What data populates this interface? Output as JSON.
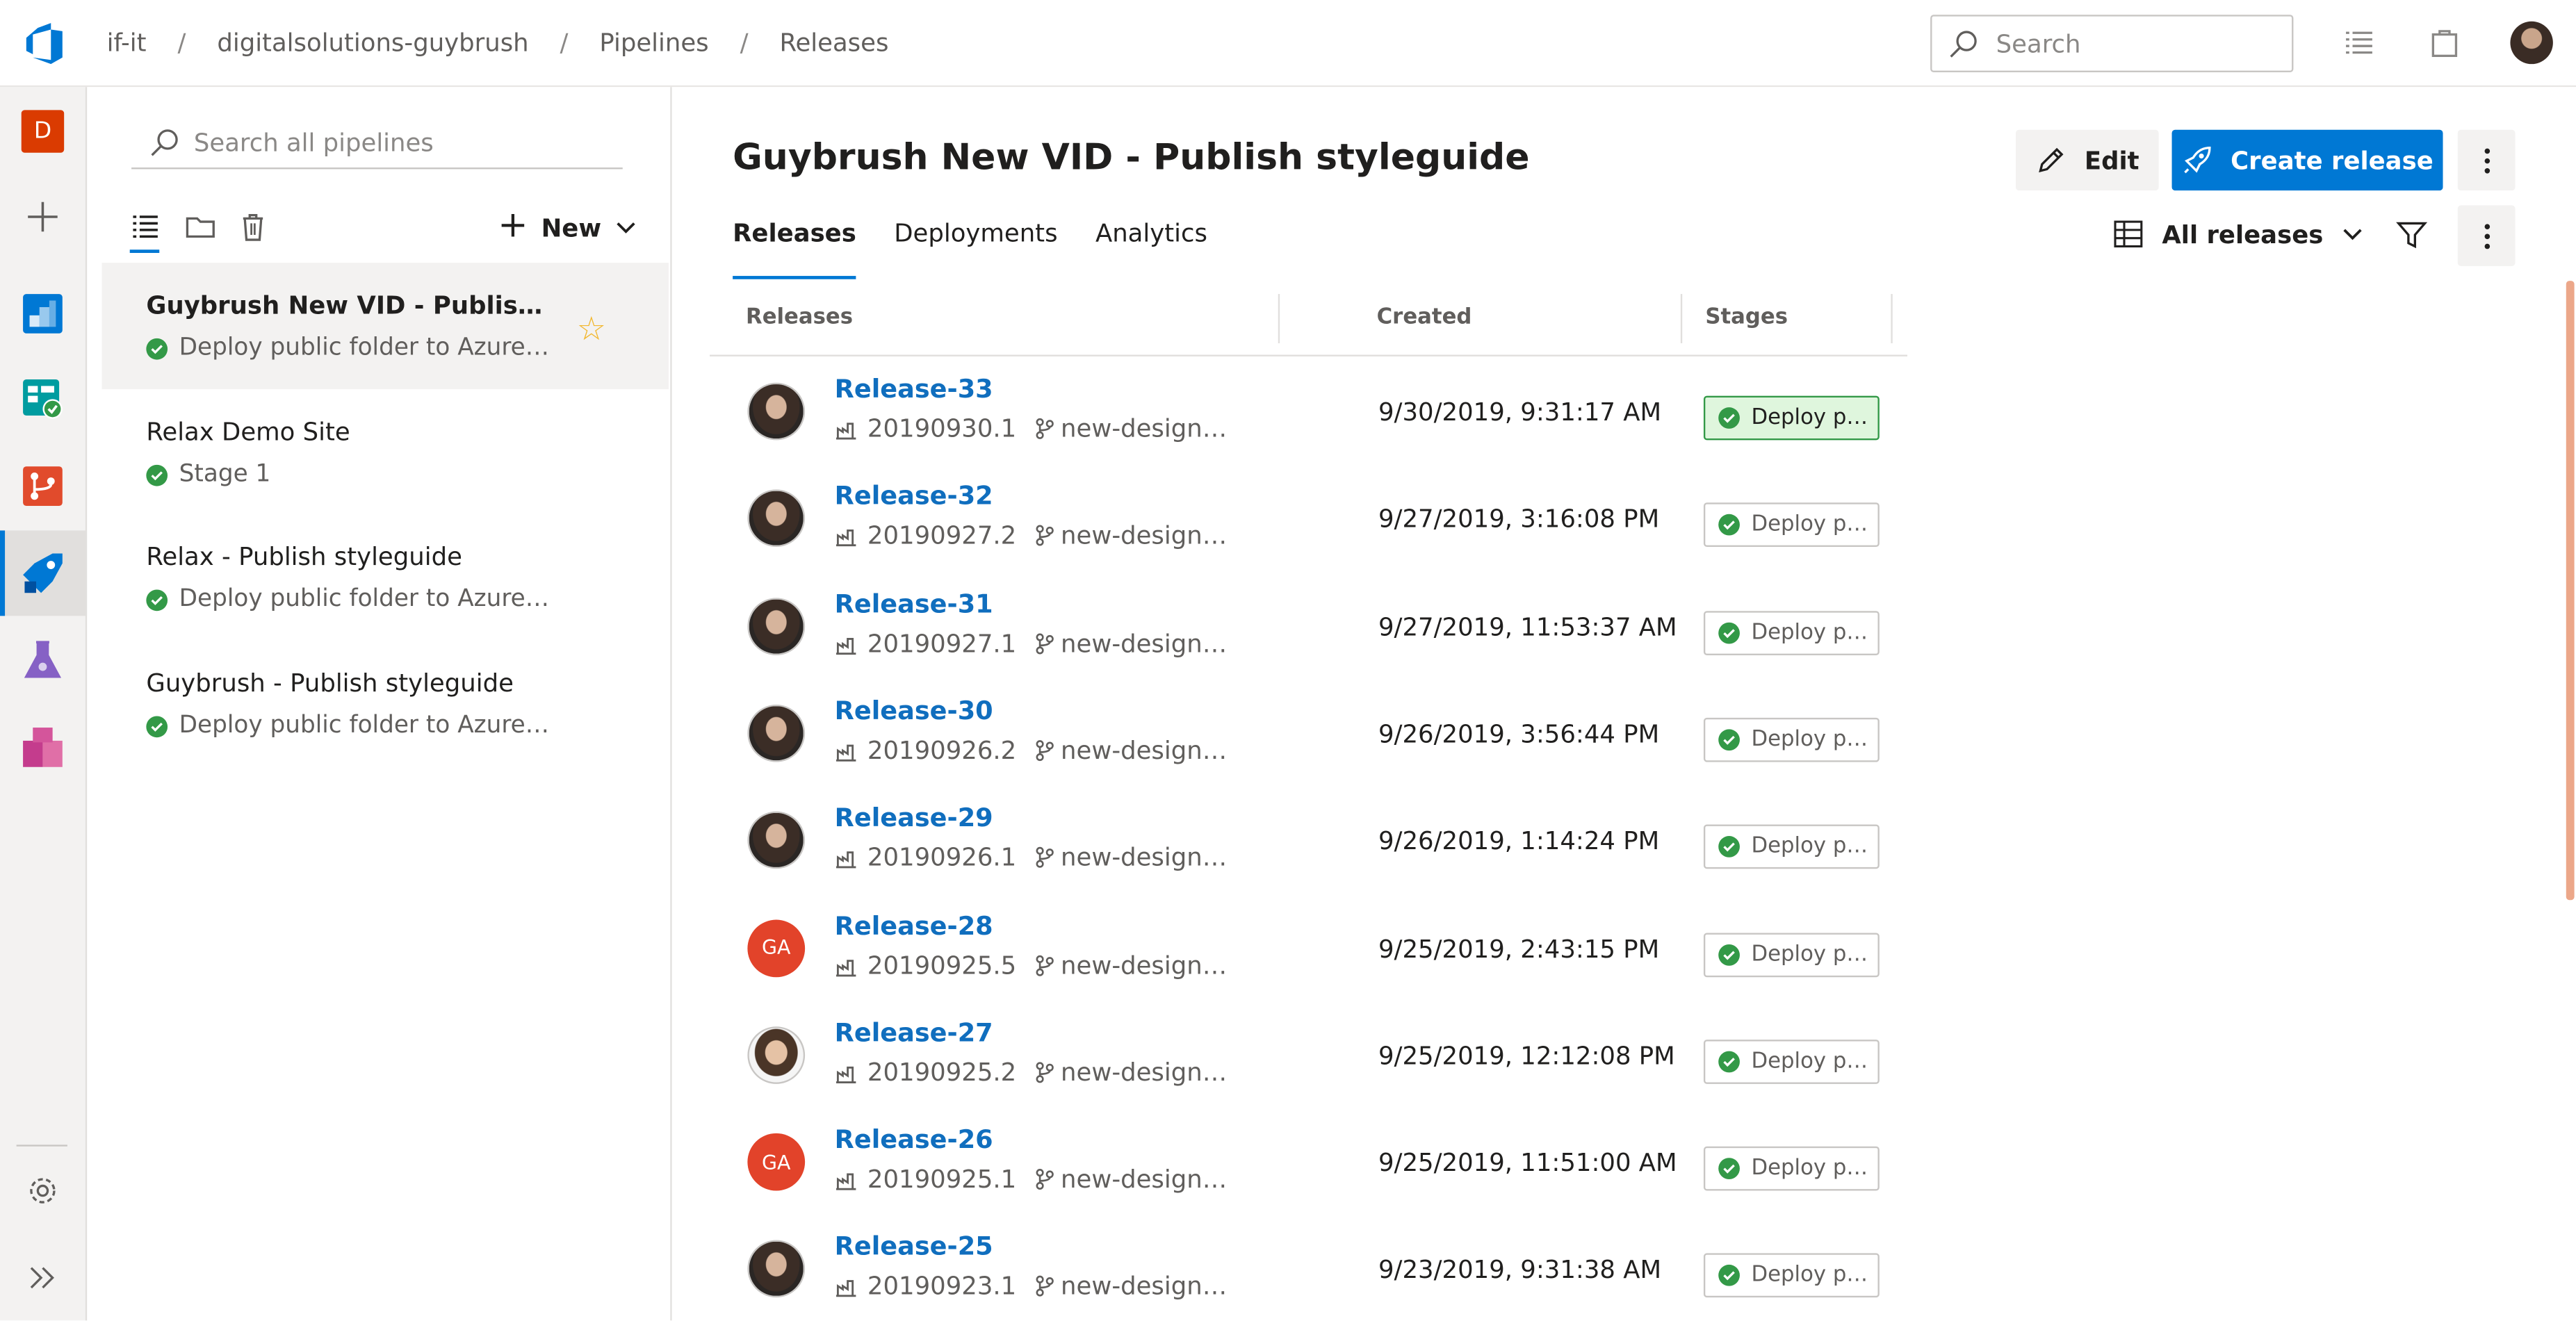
{
  "breadcrumb": [
    "if-it",
    "digitalsolutions-guybrush",
    "Pipelines",
    "Releases"
  ],
  "global_search": {
    "placeholder": "Search"
  },
  "org_badge": "D",
  "pipeline_panel": {
    "search_placeholder": "Search all pipelines",
    "new_label": "New",
    "items": [
      {
        "name": "Guybrush New VID - Publish styleguide",
        "stage": "Deploy public folder to Azure Storage",
        "status": "succeeded",
        "favorite": true,
        "selected": true
      },
      {
        "name": "Relax Demo Site",
        "stage": "Stage 1",
        "status": "succeeded",
        "favorite": false,
        "selected": false
      },
      {
        "name": "Relax - Publish styleguide",
        "stage": "Deploy public folder to Azure Storage",
        "status": "succeeded",
        "favorite": false,
        "selected": false
      },
      {
        "name": "Guybrush - Publish styleguide",
        "stage": "Deploy public folder to Azure Storage",
        "status": "succeeded",
        "favorite": false,
        "selected": false
      }
    ]
  },
  "main": {
    "title": "Guybrush New VID - Publish styleguide",
    "edit_label": "Edit",
    "create_label": "Create release",
    "tabs": [
      "Releases",
      "Deployments",
      "Analytics"
    ],
    "view_selector": "All releases",
    "columns": [
      "Releases",
      "Created",
      "Stages"
    ],
    "releases": [
      {
        "name": "Release-33",
        "build": "20190930.1",
        "branch": "new-design…",
        "created": "9/30/2019, 9:31:17 AM",
        "stage": "Deploy p…",
        "avatar": "photo",
        "latest": true
      },
      {
        "name": "Release-32",
        "build": "20190927.2",
        "branch": "new-design…",
        "created": "9/27/2019, 3:16:08 PM",
        "stage": "Deploy p…",
        "avatar": "photo",
        "latest": false
      },
      {
        "name": "Release-31",
        "build": "20190927.1",
        "branch": "new-design…",
        "created": "9/27/2019, 11:53:37 AM",
        "stage": "Deploy p…",
        "avatar": "photo",
        "latest": false
      },
      {
        "name": "Release-30",
        "build": "20190926.2",
        "branch": "new-design…",
        "created": "9/26/2019, 3:56:44 PM",
        "stage": "Deploy p…",
        "avatar": "photo",
        "latest": false
      },
      {
        "name": "Release-29",
        "build": "20190926.1",
        "branch": "new-design…",
        "created": "9/26/2019, 1:14:24 PM",
        "stage": "Deploy p…",
        "avatar": "photo",
        "latest": false
      },
      {
        "name": "Release-28",
        "build": "20190925.5",
        "branch": "new-design…",
        "created": "9/25/2019, 2:43:15 PM",
        "stage": "Deploy p…",
        "avatar": "GA",
        "latest": false
      },
      {
        "name": "Release-27",
        "build": "20190925.2",
        "branch": "new-design…",
        "created": "9/25/2019, 12:12:08 PM",
        "stage": "Deploy p…",
        "avatar": "photo2",
        "latest": false
      },
      {
        "name": "Release-26",
        "build": "20190925.1",
        "branch": "new-design…",
        "created": "9/25/2019, 11:51:00 AM",
        "stage": "Deploy p…",
        "avatar": "GA",
        "latest": false
      },
      {
        "name": "Release-25",
        "build": "20190923.1",
        "branch": "new-design…",
        "created": "9/23/2019, 9:31:38 AM",
        "stage": "Deploy p…",
        "avatar": "photo",
        "latest": false
      }
    ]
  },
  "colors": {
    "accent": "#0078d4",
    "link": "#106ebe",
    "success": "#339947",
    "org": "#da3b01",
    "ga_avatar": "#e2432a"
  }
}
